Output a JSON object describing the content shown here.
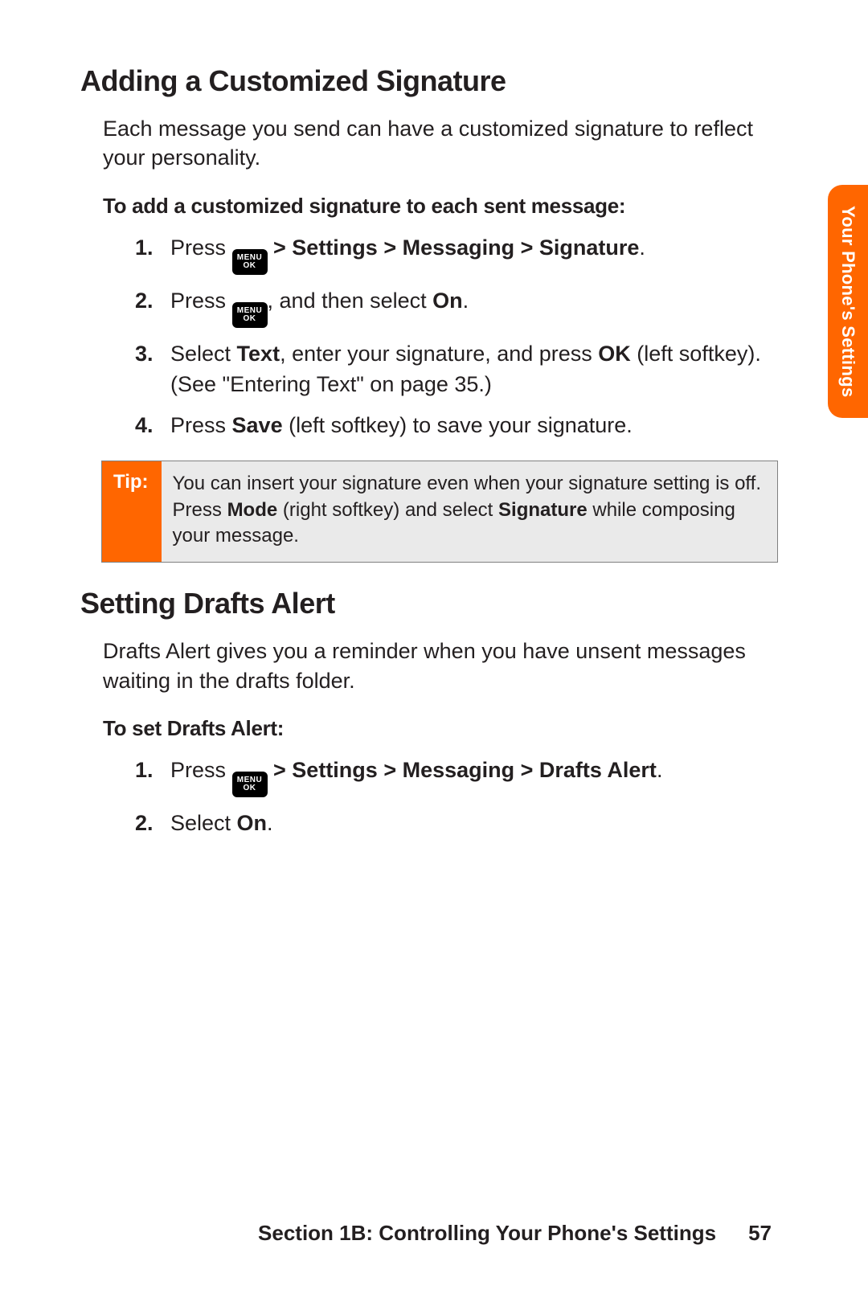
{
  "sideTab": "Your Phone's Settings",
  "menuKey": {
    "top": "MENU",
    "bottom": "OK"
  },
  "sec1": {
    "title": "Adding a Customized Signature",
    "intro": "Each message you send can have a customized signature to reflect your personality.",
    "subhead": "To add a customized signature to each sent message:",
    "steps": {
      "s1_a": "Press ",
      "s1_b": " > Settings > Messaging > Signature",
      "s1_c": ".",
      "s2_a": "Press ",
      "s2_b": ", and then select ",
      "s2_c": "On",
      "s2_d": ".",
      "s3_a": "Select ",
      "s3_b": "Text",
      "s3_c": ", enter your signature, and press ",
      "s3_d": "OK",
      "s3_e": " (left softkey). (See \"Entering Text\" on page 35.)",
      "s4_a": "Press ",
      "s4_b": "Save",
      "s4_c": " (left softkey) to save your signature."
    }
  },
  "tip": {
    "label": "Tip:",
    "t1": "You can insert your signature even when your signature setting is off. Press ",
    "t2": "Mode",
    "t3": " (right softkey) and select ",
    "t4": "Signature",
    "t5": " while composing your message."
  },
  "sec2": {
    "title": "Setting Drafts Alert",
    "intro": "Drafts Alert gives you a reminder when you have unsent messages waiting in the drafts folder.",
    "subhead": "To set Drafts Alert:",
    "steps": {
      "s1_a": "Press ",
      "s1_b": " > Settings > Messaging > Drafts Alert",
      "s1_c": ".",
      "s2_a": "Select ",
      "s2_b": "On",
      "s2_c": "."
    }
  },
  "footer": {
    "section": "Section 1B: Controlling Your Phone's Settings",
    "page": "57"
  },
  "nums": {
    "n1": "1.",
    "n2": "2.",
    "n3": "3.",
    "n4": "4."
  }
}
